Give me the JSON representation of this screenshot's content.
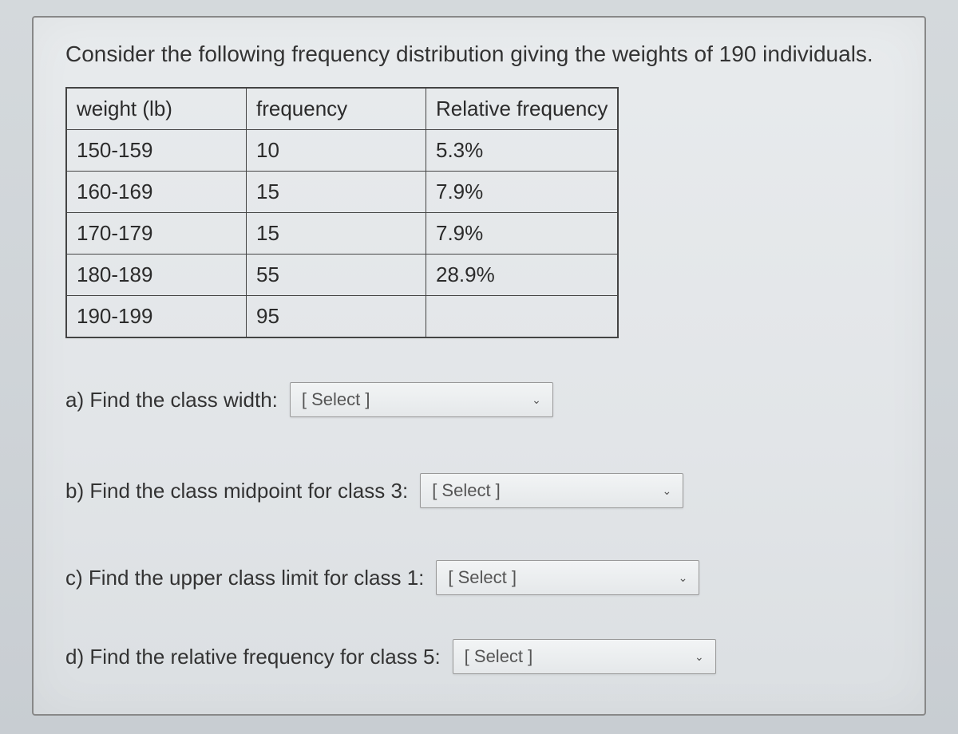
{
  "intro": "Consider the following frequency distribution giving the weights of 190 individuals.",
  "table": {
    "headers": {
      "c0": "weight (lb)",
      "c1": "frequency",
      "c2": "Relative frequency"
    },
    "rows": [
      {
        "c0": "150-159",
        "c1": "10",
        "c2": "5.3%"
      },
      {
        "c0": "160-169",
        "c1": "15",
        "c2": "7.9%"
      },
      {
        "c0": "170-179",
        "c1": "15",
        "c2": "7.9%"
      },
      {
        "c0": "180-189",
        "c1": "55",
        "c2": "28.9%"
      },
      {
        "c0": "190-199",
        "c1": "95",
        "c2": ""
      }
    ]
  },
  "questions": {
    "a": "a) Find the class width:",
    "b": "b) Find the class midpoint for class 3:",
    "c": "c) Find the upper class limit for class 1:",
    "d": "d) Find the relative frequency for class 5:"
  },
  "select_placeholder": "[ Select ]"
}
